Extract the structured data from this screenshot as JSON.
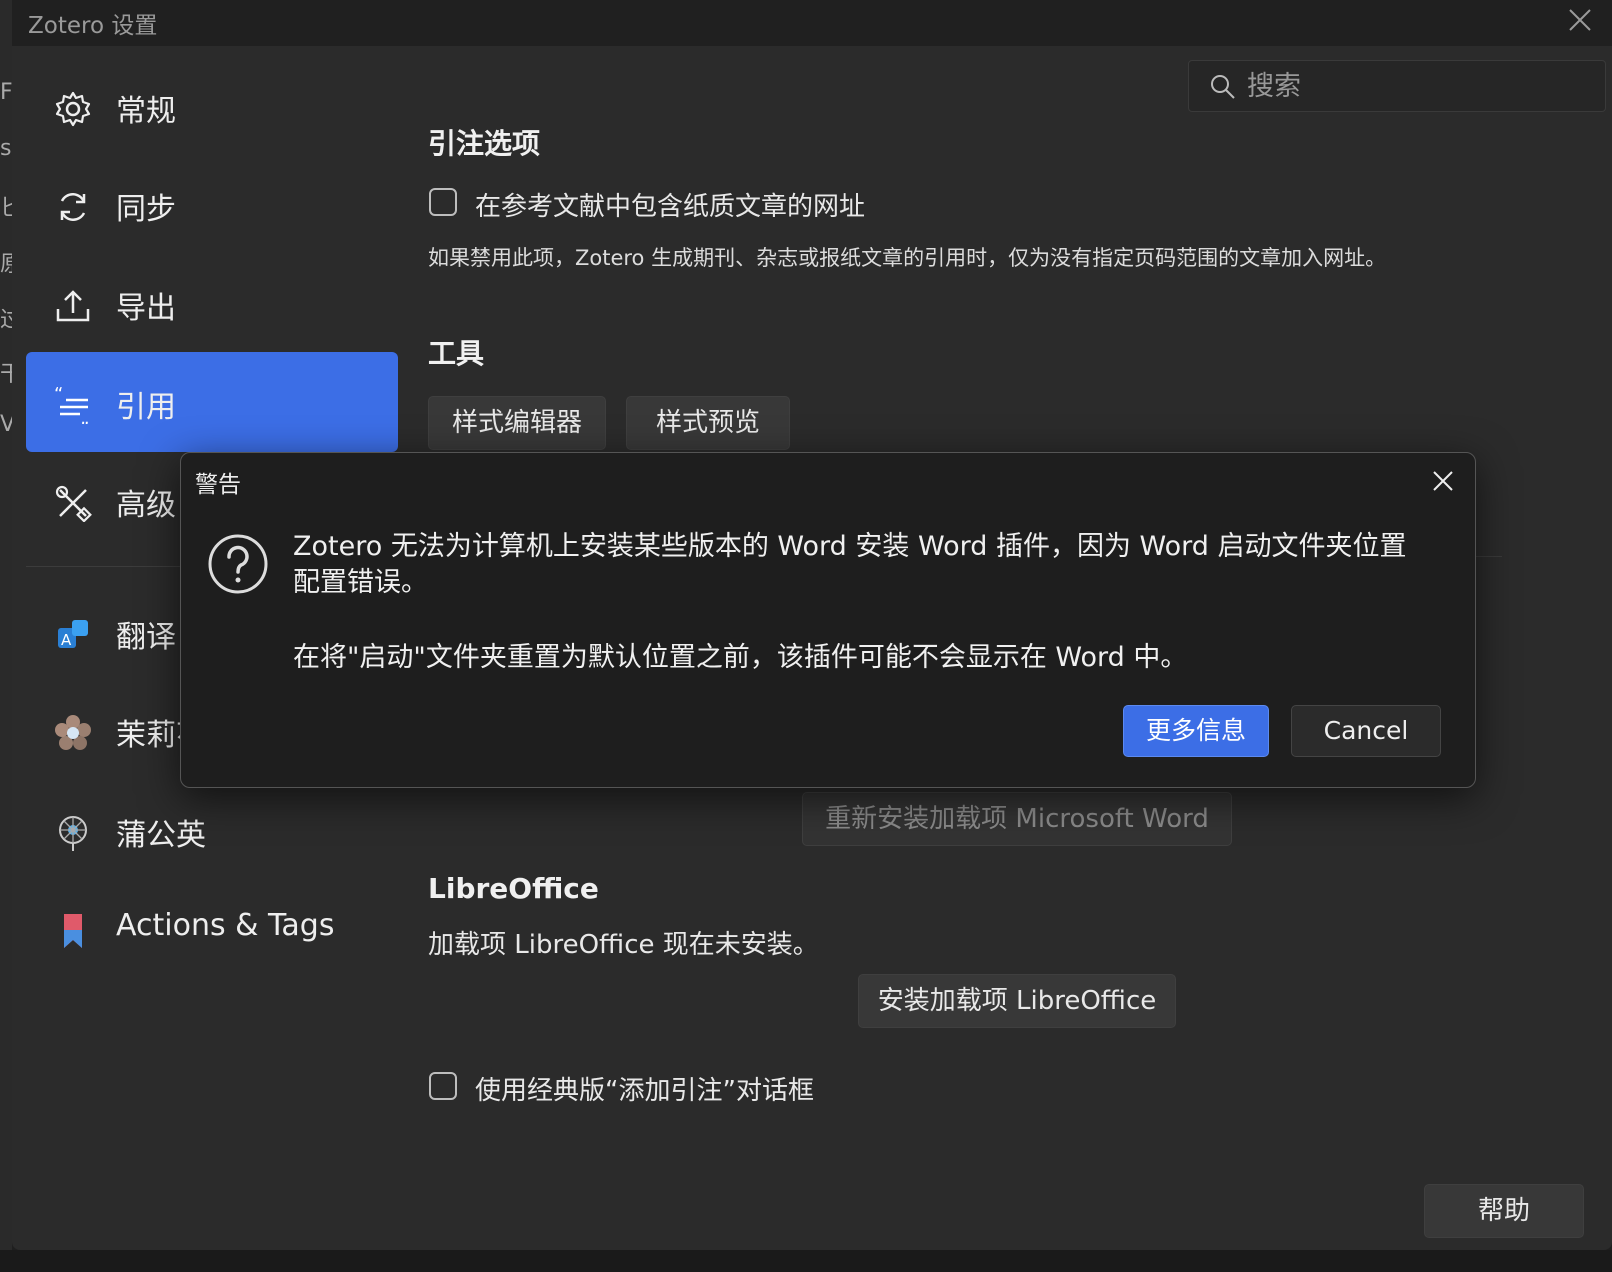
{
  "window": {
    "title": "Zotero 设置"
  },
  "background_strip": [
    "F",
    "s",
    "匕",
    "原",
    "过",
    "干",
    "V"
  ],
  "sidebar": {
    "items": [
      {
        "label": "常规",
        "icon": "gear-icon",
        "active": false
      },
      {
        "label": "同步",
        "icon": "sync-icon",
        "active": false
      },
      {
        "label": "导出",
        "icon": "export-icon",
        "active": false
      },
      {
        "label": "引用",
        "icon": "quote-icon",
        "active": true
      },
      {
        "label": "高级",
        "icon": "tools-icon",
        "active": false
      }
    ],
    "plugins": [
      {
        "label": "翻译",
        "icon": "translate-icon"
      },
      {
        "label": "茉莉花",
        "icon": "jasmine-icon"
      },
      {
        "label": "蒲公英",
        "icon": "dandelion-icon"
      },
      {
        "label": "Actions & Tags",
        "icon": "bookmark-icon"
      }
    ]
  },
  "search": {
    "placeholder": "搜索"
  },
  "citation_options": {
    "heading": "引注选项",
    "include_url_label": "在参考文献中包含纸质文章的网址",
    "include_url_checked": false,
    "description": "如果禁用此项，Zotero 生成期刊、杂志或报纸文章的引用时，仅为没有指定页码范围的文章加入网址。"
  },
  "tools": {
    "heading": "工具",
    "style_editor": "样式编辑器",
    "style_preview": "样式预览"
  },
  "word": {
    "reinstall_button": "重新安装加载项 Microsoft Word"
  },
  "libreoffice": {
    "heading": "LibreOffice",
    "status": "加载项 LibreOffice 现在未安装。",
    "install_button": "安装加载项 LibreOffice"
  },
  "classic_dialog": {
    "label": "使用经典版“添加引注”对话框",
    "checked": false
  },
  "help_button": "帮助",
  "dialog": {
    "title": "警告",
    "message_1": "Zotero 无法为计算机上安装某些版本的 Word 安装 Word 插件，因为 Word 启动文件夹位置配置错误。",
    "message_2": "在将\"启动\"文件夹重置为默认位置之前，该插件可能不会显示在 Word 中。",
    "primary_button": "更多信息",
    "cancel_button": "Cancel",
    "colors": {
      "primary": "#3c6ee6",
      "background": "#1e1e1e"
    }
  },
  "colors": {
    "accent": "#3c6ee6",
    "window_bg": "#2b2b2b",
    "titlebar_bg": "#202020"
  }
}
